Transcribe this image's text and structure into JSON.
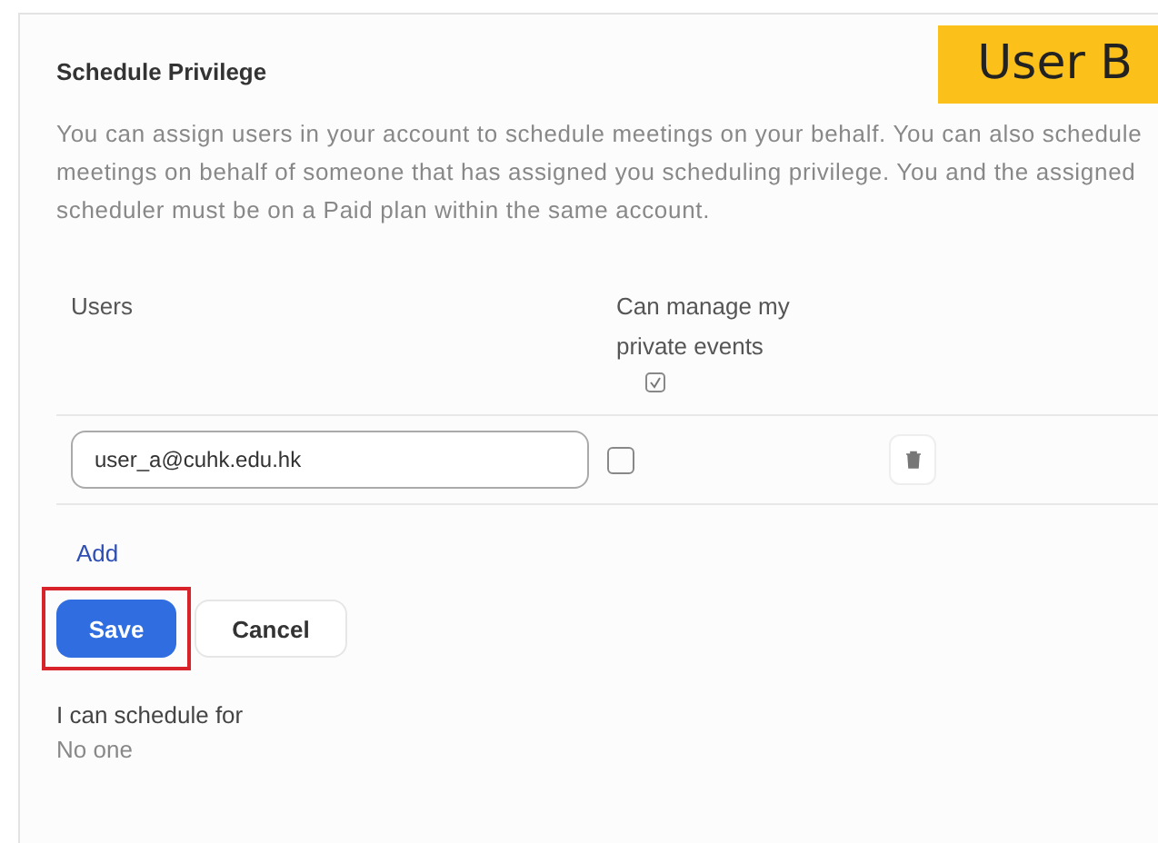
{
  "badge": {
    "label": "User B"
  },
  "section": {
    "title": "Schedule Privilege",
    "description": "You can assign users in your account to schedule meetings on your behalf. You can also schedule meetings on behalf of someone that has assigned you scheduling privilege. You and the assigned scheduler must be on a Paid plan within the same account."
  },
  "table": {
    "columns": [
      {
        "label": "Users"
      },
      {
        "label": "Can manage my private events"
      }
    ],
    "rows": [
      {
        "user": "user_a@cuhk.edu.hk",
        "checked": false
      }
    ]
  },
  "add_link": "Add",
  "buttons": [
    {
      "label": "Save",
      "kind": "primary",
      "highlighted": true
    },
    {
      "label": "Cancel",
      "kind": "secondary",
      "highlighted": false
    }
  ],
  "schedule_for": {
    "label": "I can schedule for",
    "value": "No one"
  }
}
